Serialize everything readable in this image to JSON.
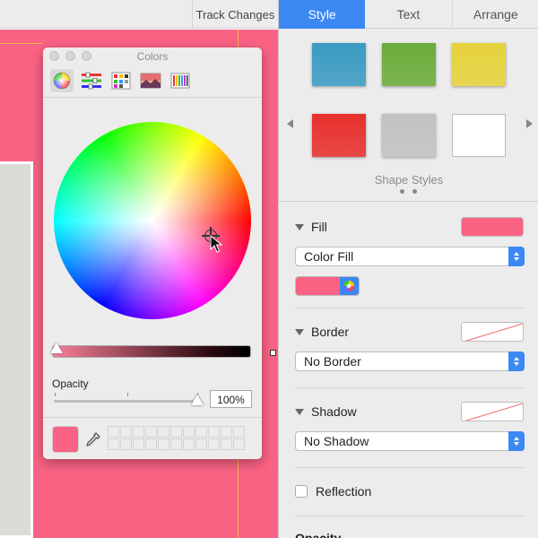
{
  "toolbar": {
    "track_changes": "Track Changes"
  },
  "colors_panel": {
    "title": "Colors",
    "modes": [
      {
        "name": "color-wheel",
        "active": true
      },
      {
        "name": "color-sliders",
        "active": false
      },
      {
        "name": "color-palettes",
        "active": false
      },
      {
        "name": "image-palettes",
        "active": false
      },
      {
        "name": "pencils",
        "active": false
      }
    ],
    "opacity_label": "Opacity",
    "opacity_value": "100%",
    "opacity_fraction": 1.0,
    "current_color": "#fb6384"
  },
  "inspector": {
    "tabs": [
      {
        "label": "Style",
        "active": true
      },
      {
        "label": "Text",
        "active": false
      },
      {
        "label": "Arrange",
        "active": false
      }
    ],
    "shape_styles_label": "Shape Styles",
    "shape_style_colors": [
      "#3a9bc2",
      "#6bac3a",
      "#e6d23a",
      "#e8302d",
      "#c2c2c2",
      "#ffffff"
    ],
    "fill": {
      "label": "Fill",
      "color": "#fb6384",
      "type": "Color Fill"
    },
    "border": {
      "label": "Border",
      "type": "No Border"
    },
    "shadow": {
      "label": "Shadow",
      "type": "No Shadow"
    },
    "reflection_label": "Reflection",
    "opacity_section_label": "Opacity"
  },
  "colors": {
    "accent": "#3c88f3",
    "canvas": "#fb6384"
  }
}
